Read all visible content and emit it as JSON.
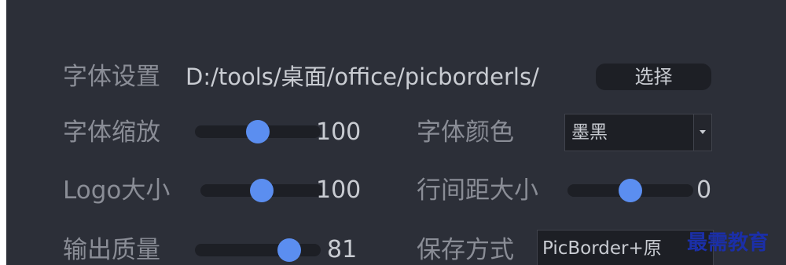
{
  "font_settings": {
    "label": "字体设置",
    "path": "D:/tools/桌面/office/picborderls/",
    "choose_button": "选择"
  },
  "font_scale": {
    "label": "字体缩放",
    "value": "100",
    "level": 0.5
  },
  "font_color": {
    "label": "字体颜色",
    "selected": "墨黑"
  },
  "logo_size": {
    "label": "Logo大小",
    "value": "100",
    "level": 0.5
  },
  "line_spacing": {
    "label": "行间距大小",
    "value": "0",
    "level": 0.5
  },
  "output_quality": {
    "label": "输出质量",
    "value": "81",
    "level": 0.81
  },
  "save_mode": {
    "label": "保存方式",
    "selected": "PicBorder+原"
  },
  "watermark": "最需教育",
  "colors": {
    "background": "#2c2f38",
    "accent": "#5b8ef0",
    "control": "#1d1f25"
  },
  "icons": {
    "dropdown": "chevron-down-icon"
  }
}
